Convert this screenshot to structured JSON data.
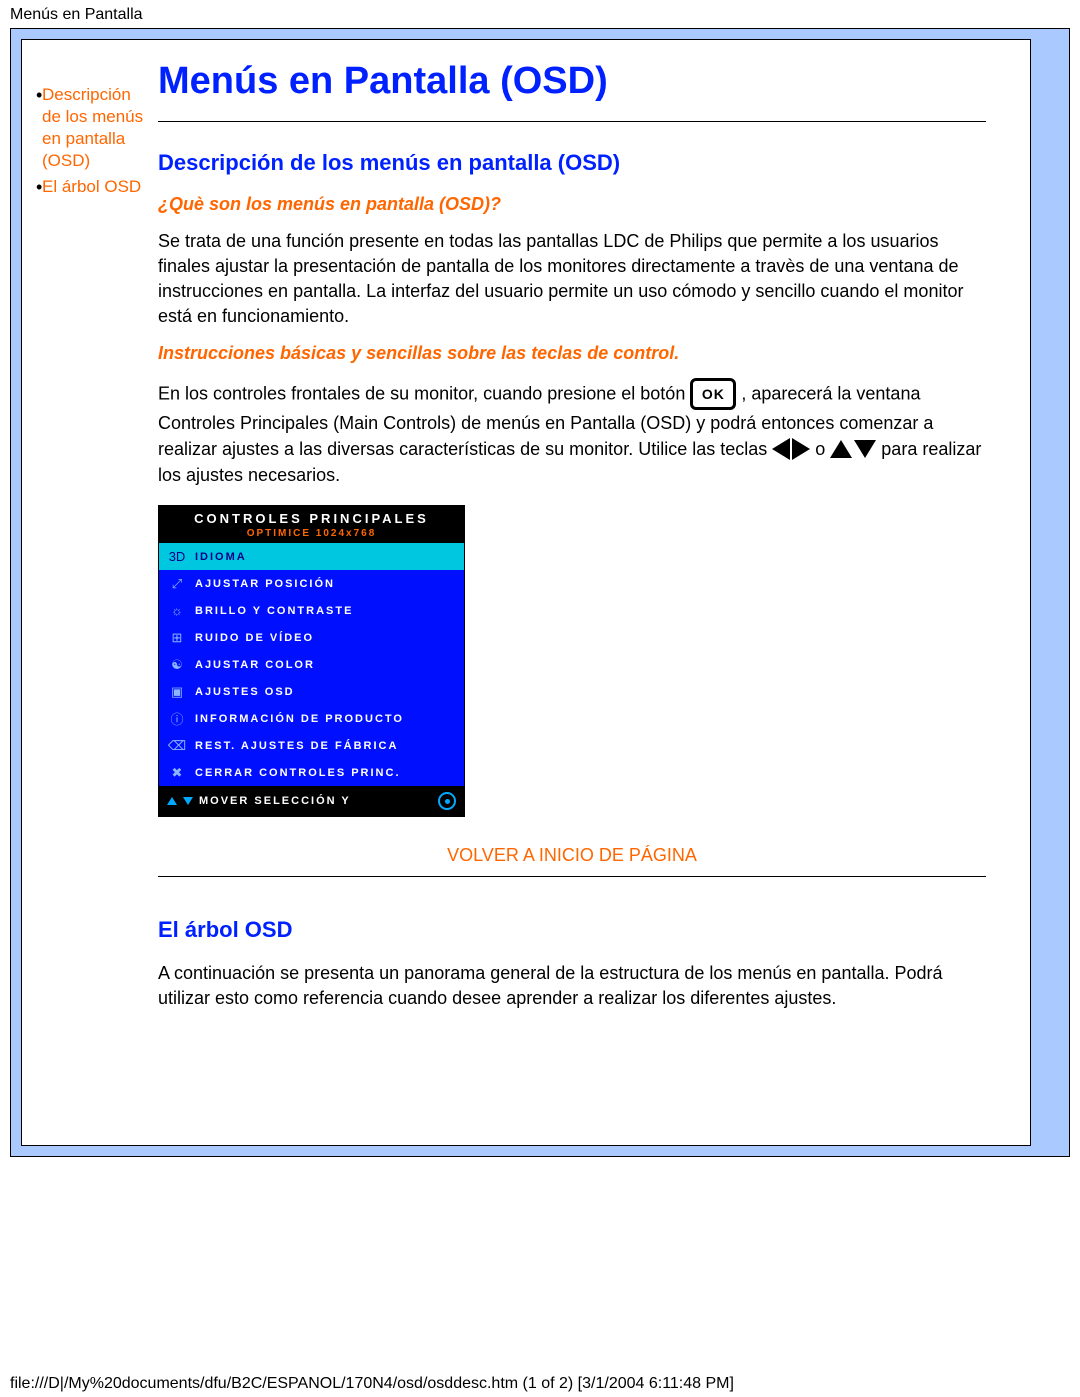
{
  "page_title_band": "Menús en Pantalla",
  "left_nav": {
    "items": [
      {
        "label": "Descripción de los menús en pantalla (OSD)"
      },
      {
        "label": "El árbol OSD"
      }
    ]
  },
  "main": {
    "title": "Menús en Pantalla (OSD)",
    "section1_title": "Descripción de los menús en pantalla (OSD)",
    "q1": "¿Què son los menús en pantalla (OSD)?",
    "p1": "Se trata de una función presente en todas las pantallas LDC de Philips que permite a los usuarios finales ajustar la presentación de pantalla de los monitores directamente a travès de una ventana de instrucciones en pantalla. La interfaz del usuario permite un uso cómodo y sencillo cuando el monitor está en funcionamiento.",
    "q2": "Instrucciones básicas y sencillas sobre las teclas de control.",
    "p2_parts": {
      "a": "En los controles frontales de su monitor, cuando presione el botón ",
      "b": ", aparecerá la ventana Controles Principales (Main Controls) de menús en Pantalla (OSD) y podrá entonces comenzar a realizar ajustes a las diversas características de su monitor. Utilice las teclas ",
      "c": " o ",
      "d": " para realizar los ajustes necesarios."
    },
    "back_to_top": "VOLVER A INICIO DE PÁGINA",
    "section2_title": "El árbol OSD",
    "p3": "A continuación se presenta un panorama general de la estructura de los menús en pantalla. Podrá utilizar esto como referencia cuando desee aprender a realizar los diferentes ajustes."
  },
  "osd_menu": {
    "header": "CONTROLES PRINCIPALES",
    "sub": "OPTIMICE 1024x768",
    "rows": [
      {
        "icon": "3D",
        "label": "IDIOMA",
        "selected": true
      },
      {
        "icon": "⤢",
        "label": "AJUSTAR POSICIÓN",
        "selected": false
      },
      {
        "icon": "☼",
        "label": "BRILLO Y CONTRASTE",
        "selected": false
      },
      {
        "icon": "⊞",
        "label": "RUIDO DE VÍDEO",
        "selected": false
      },
      {
        "icon": "☯",
        "label": "AJUSTAR COLOR",
        "selected": false
      },
      {
        "icon": "▣",
        "label": "AJUSTES OSD",
        "selected": false
      },
      {
        "icon": "ⓘ",
        "label": "INFORMACIÓN DE PRODUCTO",
        "selected": false
      },
      {
        "icon": "⌫",
        "label": "REST. AJUSTES DE FÁBRICA",
        "selected": false
      },
      {
        "icon": "✖",
        "label": "CERRAR CONTROLES PRINC.",
        "selected": false
      }
    ],
    "footer_label": "MOVER SELECCIÓN Y"
  },
  "footer_path": "file:///D|/My%20documents/dfu/B2C/ESPANOL/170N4/osd/osddesc.htm (1 of 2) [3/1/2004 6:11:48 PM]"
}
